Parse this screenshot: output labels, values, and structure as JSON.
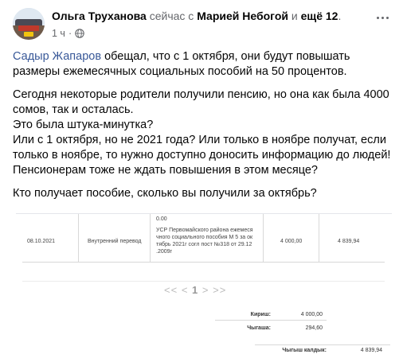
{
  "post": {
    "author": "Ольга Труханова",
    "with_prefix": "сейчас с",
    "tagged_person": "Марией Небогой",
    "and_word": "и",
    "tagged_more": "ещё 12",
    "period": ".",
    "time": "1 ч",
    "time_sep": "·",
    "icons": {
      "privacy": "globe-icon",
      "menu": "more-horizontal-icon"
    },
    "mention": "Садыр Жапаров",
    "p1_rest": " обещал, что с 1 октября, они будут повышать размеры ежемесячных социальных пособий на 50 процентов.",
    "p2_lines": [
      "Сегодня некоторые родители получили пенсию, но она как была 4000 сомов, так и осталась.",
      "Это была штука-минутка?",
      "Или с 1 октября, но не 2021 года?  Или только в ноябре получат, если только в ноябре, то нужно доступно доносить информацию до людей! Пенсионерам тоже не ждать повышения в этом месяце?"
    ],
    "p3": "Кто получает пособие, сколько вы получили за октябрь?"
  },
  "attachment": {
    "top_stub": "0.00",
    "row": {
      "date": "08.10.2021",
      "type": "Внутренний перевод",
      "description": "УСР Первомайского района ежемеся чного социального пособия М 5 за ок тябрь 2021г согл пост №318 от 29.12 .2009г",
      "amount": "4 000,00",
      "balance": "4 839,94"
    },
    "pager": {
      "prev_prev": "<<",
      "prev": "<",
      "page": "1",
      "next": ">",
      "next_next": ">>"
    },
    "totals": {
      "income_label": "Кириш:",
      "income_value": "4 000,00",
      "expense_label": "Чыгаша:",
      "expense_value": "294,60",
      "closing_label": "Чыгыш калдык:",
      "closing_value": "4 839,94"
    }
  },
  "colors": {
    "mention": "#385898",
    "secondary": "#65676b",
    "text": "#050505"
  }
}
